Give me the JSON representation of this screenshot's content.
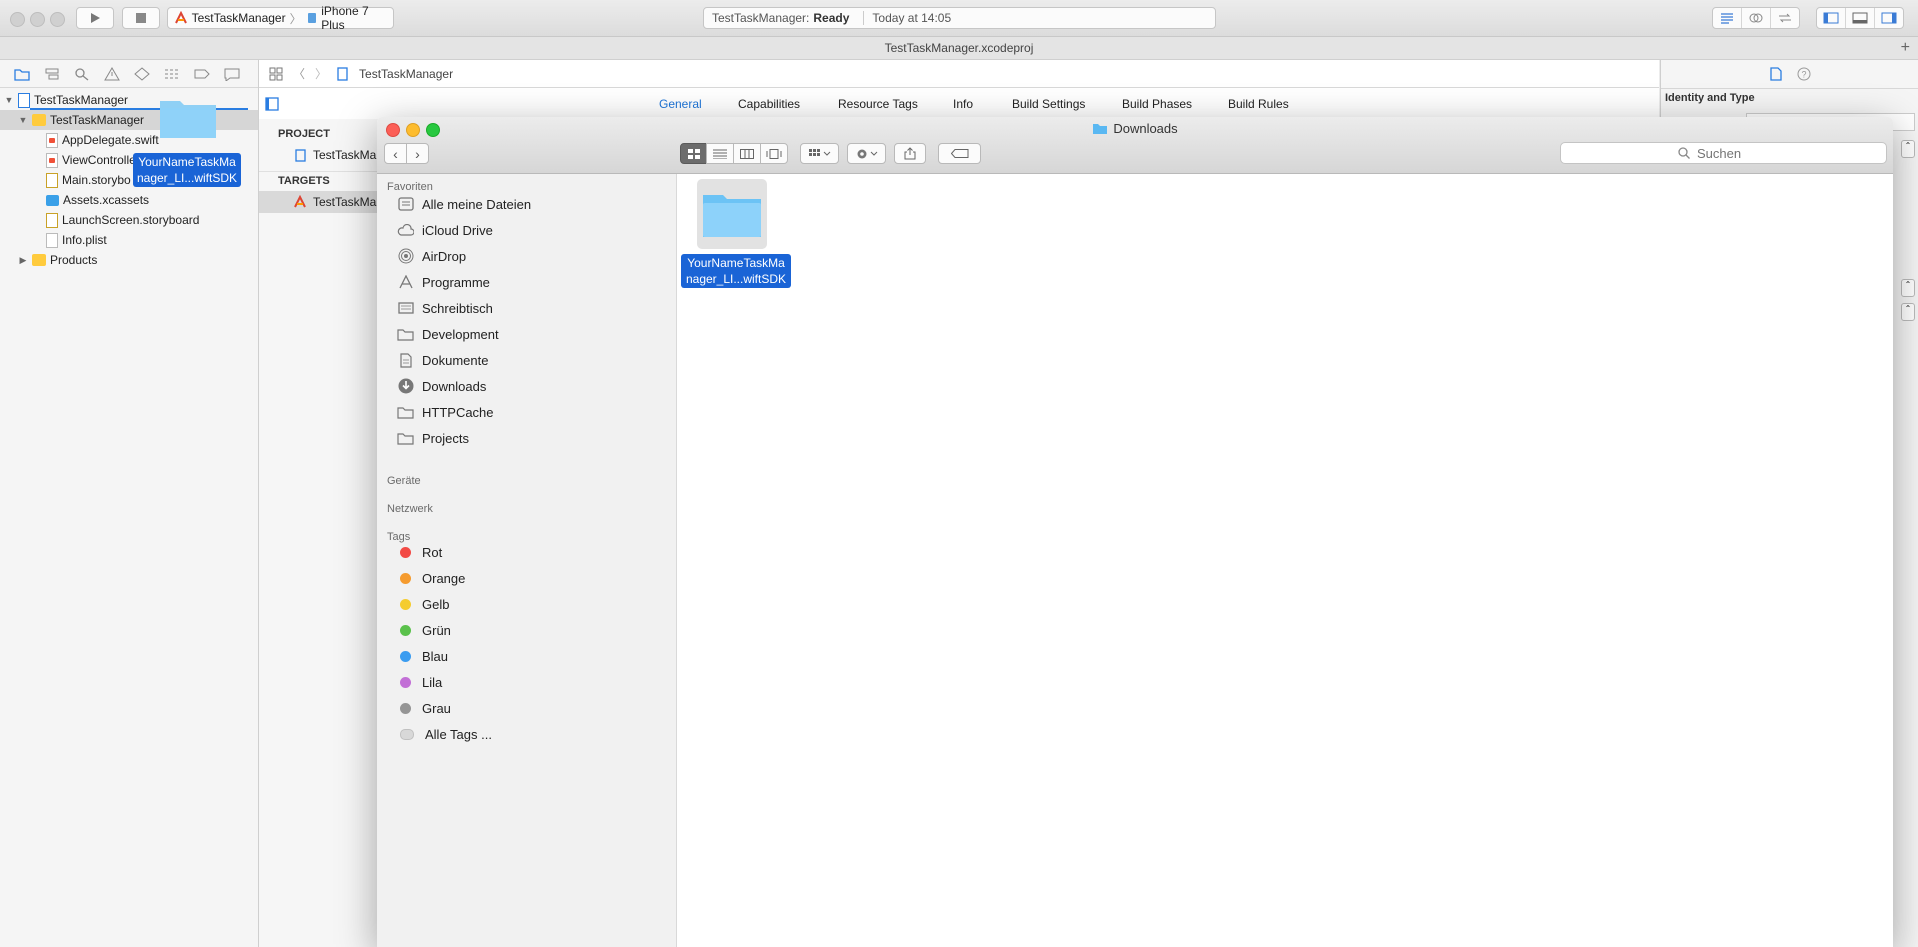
{
  "toolbar": {
    "scheme_name": "TestTaskManager",
    "device": "iPhone 7 Plus",
    "status_project": "TestTaskManager:",
    "status_state": "Ready",
    "status_time": "Today at 14:05"
  },
  "window_title": "TestTaskManager.xcodeproj",
  "navigator": {
    "items": [
      {
        "label": "TestTaskManager"
      },
      {
        "label": "TestTaskManager"
      },
      {
        "label": "AppDelegate.swift"
      },
      {
        "label": "ViewControlle"
      },
      {
        "label": "Main.storybo"
      },
      {
        "label": "Assets.xcassets"
      },
      {
        "label": "LaunchScreen.storyboard"
      },
      {
        "label": "Info.plist"
      },
      {
        "label": "Products"
      }
    ],
    "drag_label_line1": "YourNameTaskMa",
    "drag_label_line2": "nager_LI...wiftSDK"
  },
  "editor": {
    "jump_target": "TestTaskManager",
    "tabs": [
      "General",
      "Capabilities",
      "Resource Tags",
      "Info",
      "Build Settings",
      "Build Phases",
      "Build Rules"
    ],
    "project_header": "PROJECT",
    "project_item": "TestTaskMar",
    "targets_header": "TARGETS",
    "target_item": "TestTaskMar"
  },
  "inspector": {
    "section_title": "Identity and Type"
  },
  "finder": {
    "title": "Downloads",
    "search_placeholder": "Suchen",
    "favorites_header": "Favoriten",
    "favorites": [
      {
        "label": "Alle meine Dateien",
        "icon": "all-files-icon"
      },
      {
        "label": "iCloud Drive",
        "icon": "cloud-icon"
      },
      {
        "label": "AirDrop",
        "icon": "airdrop-icon"
      },
      {
        "label": "Programme",
        "icon": "applications-icon"
      },
      {
        "label": "Schreibtisch",
        "icon": "desktop-icon"
      },
      {
        "label": "Development",
        "icon": "folder-icon"
      },
      {
        "label": "Dokumente",
        "icon": "documents-icon"
      },
      {
        "label": "Downloads",
        "icon": "downloads-icon"
      },
      {
        "label": "HTTPCache",
        "icon": "folder-icon"
      },
      {
        "label": "Projects",
        "icon": "folder-icon"
      }
    ],
    "devices_header": "Geräte",
    "network_header": "Netzwerk",
    "tags_header": "Tags",
    "tags": [
      {
        "label": "Rot",
        "color": "#f24a45"
      },
      {
        "label": "Orange",
        "color": "#f59b2e"
      },
      {
        "label": "Gelb",
        "color": "#f5cc2e"
      },
      {
        "label": "Grün",
        "color": "#5ac14b"
      },
      {
        "label": "Blau",
        "color": "#3a9cf0"
      },
      {
        "label": "Lila",
        "color": "#c26fd6"
      },
      {
        "label": "Grau",
        "color": "#959595"
      },
      {
        "label": "Alle Tags ...",
        "color": "#d8d8d8"
      }
    ],
    "file_line1": "YourNameTaskMa",
    "file_line2": "nager_LI...wiftSDK"
  }
}
